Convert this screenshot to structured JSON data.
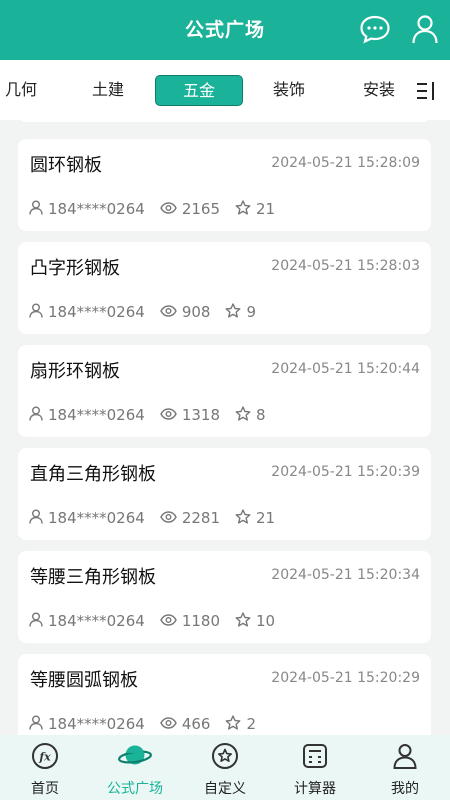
{
  "header": {
    "title": "公式广场"
  },
  "tabs": {
    "items": [
      "几何",
      "土建",
      "五金",
      "装饰",
      "安装"
    ],
    "active": "五金"
  },
  "cards": [
    {
      "name": "圆环钢板",
      "time": "2024-05-21 15:28:09",
      "user": "184****0264",
      "views": "2165",
      "stars": "21"
    },
    {
      "name": "凸字形钢板",
      "time": "2024-05-21 15:28:03",
      "user": "184****0264",
      "views": "908",
      "stars": "9"
    },
    {
      "name": "扇形环钢板",
      "time": "2024-05-21 15:20:44",
      "user": "184****0264",
      "views": "1318",
      "stars": "8"
    },
    {
      "name": "直角三角形钢板",
      "time": "2024-05-21 15:20:39",
      "user": "184****0264",
      "views": "2281",
      "stars": "21"
    },
    {
      "name": "等腰三角形钢板",
      "time": "2024-05-21 15:20:34",
      "user": "184****0264",
      "views": "1180",
      "stars": "10"
    },
    {
      "name": "等腰圆弧钢板",
      "time": "2024-05-21 15:20:29",
      "user": "184****0264",
      "views": "466",
      "stars": "2"
    }
  ],
  "tabbar": {
    "items": [
      {
        "label": "首页",
        "icon": "fx-icon"
      },
      {
        "label": "公式广场",
        "icon": "planet-icon",
        "active": true
      },
      {
        "label": "自定义",
        "icon": "star-badge-icon"
      },
      {
        "label": "计算器",
        "icon": "calculator-icon"
      },
      {
        "label": "我的",
        "icon": "person-icon"
      }
    ]
  },
  "colors": {
    "accent": "#1ab39a",
    "background": "#f2f4f4",
    "tabbar_bg": "#eaf7f4"
  }
}
